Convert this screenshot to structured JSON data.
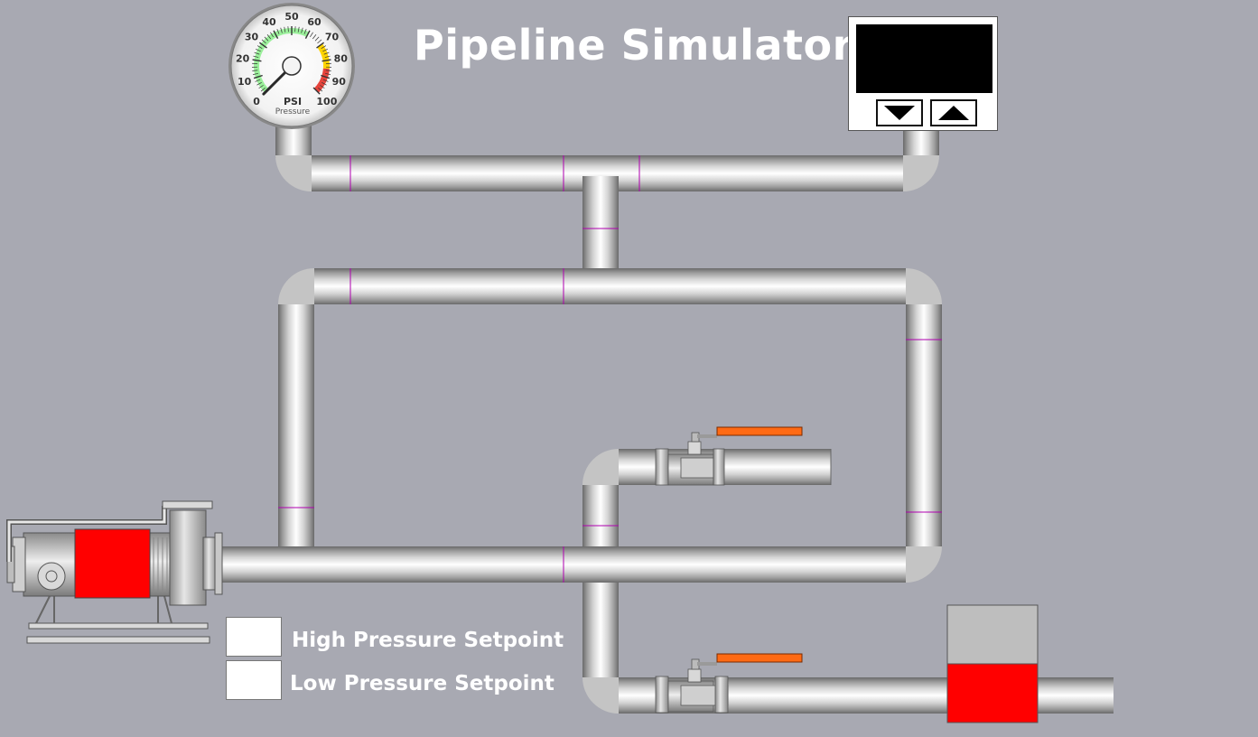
{
  "app": {
    "title": "Pipeline Simulator"
  },
  "gauge": {
    "unit": "PSI",
    "caption": "Pressure",
    "ticks": [
      "0",
      "10",
      "20",
      "30",
      "40",
      "50",
      "60",
      "70",
      "80",
      "90",
      "100"
    ],
    "min": 0,
    "max": 100,
    "value": 0,
    "zones": {
      "green": [
        0,
        60
      ],
      "yellow": [
        70,
        85
      ],
      "red": [
        85,
        100
      ]
    }
  },
  "display": {
    "readout": ""
  },
  "setpoints": {
    "high_label": "High Pressure Setpoint",
    "low_label": "Low Pressure Setpoint",
    "high_value": "",
    "low_value": ""
  },
  "colors": {
    "background": "#a8a9b2",
    "pump_motor": "#ff0000",
    "valve_handle": "#ff6a13",
    "tank_level": "#ff0000",
    "tank_empty": "#bebebe",
    "weld_marks": "#b000b0"
  },
  "tank": {
    "level_percent": 50
  },
  "icons": {
    "pump": "centrifugal-pump-icon",
    "valve": "ball-valve-icon",
    "down": "triangle-down-icon",
    "up": "triangle-up-icon"
  }
}
